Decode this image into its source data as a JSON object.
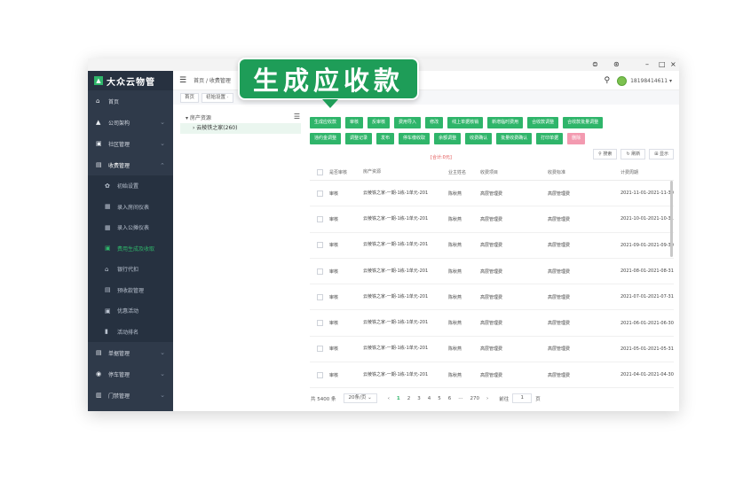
{
  "window": {
    "controls": [
      "⊜",
      "⊛",
      "–",
      "□",
      "×"
    ]
  },
  "sidebar": {
    "logo": "大众云物管",
    "items": [
      {
        "label": "首页",
        "icon": "home-icon",
        "glyph": "⌂"
      },
      {
        "label": "公司架构",
        "icon": "org-icon",
        "glyph": "▲"
      },
      {
        "label": "社区管理",
        "icon": "building-icon",
        "glyph": "▣"
      },
      {
        "label": "收费管理",
        "icon": "billing-icon",
        "glyph": "▤"
      }
    ],
    "subitems": [
      {
        "label": "初始设置",
        "icon": "settings-icon",
        "glyph": "✿"
      },
      {
        "label": "录入房间仪表",
        "icon": "meter-icon",
        "glyph": "▦"
      },
      {
        "label": "录入公摊仪表",
        "icon": "meter-icon",
        "glyph": "▦"
      },
      {
        "label": "费用生成及收取",
        "icon": "fee-icon",
        "glyph": "▣"
      },
      {
        "label": "银行代扣",
        "icon": "bank-icon",
        "glyph": "⌂"
      },
      {
        "label": "预收款管理",
        "icon": "prepay-icon",
        "glyph": "▤"
      },
      {
        "label": "优惠活动",
        "icon": "promo-icon",
        "glyph": "▣"
      },
      {
        "label": "活动排名",
        "icon": "rank-icon",
        "glyph": "▮"
      }
    ],
    "bottom_items": [
      {
        "label": "单据管理",
        "icon": "doc-icon",
        "glyph": "▤"
      },
      {
        "label": "停车管理",
        "icon": "parking-icon",
        "glyph": "◉"
      },
      {
        "label": "门禁管理",
        "icon": "door-icon",
        "glyph": "▥"
      }
    ],
    "chevron": "⌄"
  },
  "topbar": {
    "menu_glyph": "☰",
    "breadcrumb": "首页 / 收费管理",
    "search_glyph": "⚲",
    "phone": "18198414611 ▾"
  },
  "tags": [
    "首页",
    "初始设置 ·"
  ],
  "tree": {
    "root": "▾ 房产资源",
    "node": "› 云棱铁之家(260)",
    "menu_glyph": "☰"
  },
  "buttons_row1": [
    "生成应收款",
    "审核",
    "反审核",
    "费用导入",
    "修改",
    "线上单据核销",
    "新增临时费用",
    "合收款调整",
    "合收款批量调整"
  ],
  "buttons_row2": [
    "违约金调整",
    "调整记录",
    "发布",
    "停车缴收取",
    "余额调整",
    "收费确认",
    "批量收费确认",
    "打印单据",
    "删除"
  ],
  "tools": [
    "⚲ 搜索",
    "↻ 刷新",
    "⊞ 显示"
  ],
  "summary": "[合计:0元]",
  "table": {
    "headers": [
      "是否审核",
      "房产资源",
      "业主姓名",
      "收费项目",
      "收费标准",
      "计费周期"
    ],
    "rows": [
      {
        "audit": "审核",
        "resource": "云棱铁之家-一期-1栋-1单元-201",
        "owner": "陈秋燕",
        "item": "高层管理费",
        "standard": "高层管理费",
        "period": "2021-11-01-2021-11-30"
      },
      {
        "audit": "审核",
        "resource": "云棱铁之家-一期-1栋-1单元-201",
        "owner": "陈秋燕",
        "item": "高层管理费",
        "standard": "高层管理费",
        "period": "2021-10-01-2021-10-31"
      },
      {
        "audit": "审核",
        "resource": "云棱铁之家-一期-1栋-1单元-201",
        "owner": "陈秋燕",
        "item": "高层管理费",
        "standard": "高层管理费",
        "period": "2021-09-01-2021-09-30"
      },
      {
        "audit": "审核",
        "resource": "云棱铁之家-一期-1栋-1单元-201",
        "owner": "陈秋燕",
        "item": "高层管理费",
        "standard": "高层管理费",
        "period": "2021-08-01-2021-08-31"
      },
      {
        "audit": "审核",
        "resource": "云棱铁之家-一期-1栋-1单元-201",
        "owner": "陈秋燕",
        "item": "高层管理费",
        "standard": "高层管理费",
        "period": "2021-07-01-2021-07-31"
      },
      {
        "audit": "审核",
        "resource": "云棱铁之家-一期-1栋-1单元-201",
        "owner": "陈秋燕",
        "item": "高层管理费",
        "standard": "高层管理费",
        "period": "2021-06-01-2021-06-30"
      },
      {
        "audit": "审核",
        "resource": "云棱铁之家-一期-1栋-1单元-201",
        "owner": "陈秋燕",
        "item": "高层管理费",
        "standard": "高层管理费",
        "period": "2021-05-01-2021-05-31"
      },
      {
        "audit": "审核",
        "resource": "云棱铁之家-一期-1栋-1单元-201",
        "owner": "陈秋燕",
        "item": "高层管理费",
        "standard": "高层管理费",
        "period": "2021-04-01-2021-04-30"
      }
    ]
  },
  "pager": {
    "total": "共 5400 条",
    "page_size": "20条/页 ⌄",
    "prev": "‹",
    "pages": [
      "1",
      "2",
      "3",
      "4",
      "5",
      "6",
      "···",
      "270"
    ],
    "next": "›",
    "jump_label": "前往",
    "jump_value": "1",
    "jump_suffix": "页"
  },
  "callout": "生成应收款",
  "colors": {
    "accent": "#2fb56a",
    "sidebar": "#2f3a4a",
    "danger": "#f39ab0"
  }
}
